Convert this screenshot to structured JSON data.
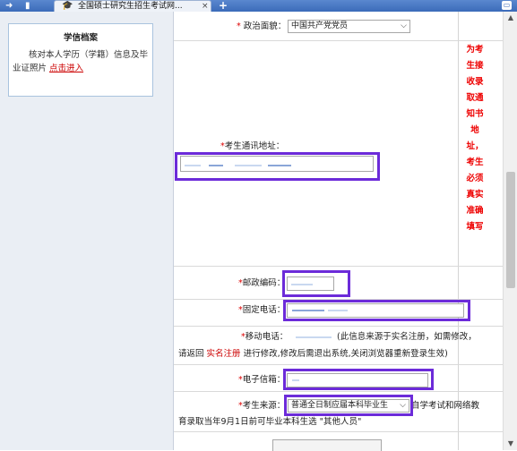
{
  "browser": {
    "tab_title": "全国硕士研究生招生考试网...",
    "tab_close": "×",
    "add_tab": "+",
    "icons": [
      "arrow-right-icon",
      "document-icon",
      "graduation-cap-icon",
      "close-icon",
      "add-tab-icon",
      "minimize-icon"
    ]
  },
  "sidebar": {
    "title": "学信档案",
    "text": "核对本人学历（学籍）信息及毕业证照片",
    "link": "点击进入"
  },
  "form": {
    "political": {
      "label": "政治面貌：",
      "value": "中国共产党党员"
    },
    "address": {
      "label": "考生通讯地址："
    },
    "postcode": {
      "label": "邮政编码："
    },
    "phone": {
      "label": "固定电话："
    },
    "mobile": {
      "label": "移动电话：",
      "note1": "(此信息来源于实名注册，如需修改，",
      "note2_pre": "请返回",
      "note2_link": "实名注册",
      "note2_post": "进行修改,修改后需退出系统,关闭浏览器重新登录生效)"
    },
    "email": {
      "label": "电子信箱："
    },
    "source": {
      "label": "考生来源：",
      "value": "普通全日制应届本科毕业生",
      "note_right": "自学考试和网络教",
      "note_line2": "育录取当年9月1日前可毕业本科生选 \"其他人员\""
    },
    "required_mark": "*"
  },
  "side_note": [
    "为考",
    "生接",
    "收录",
    "取通",
    "知书",
    "地",
    "址，",
    "考生",
    "必须",
    "真实",
    "准确",
    "填写"
  ],
  "colors": {
    "highlight": "#6c2bd9",
    "required": "#dd0000",
    "tabbar": "#3b6bb9"
  }
}
